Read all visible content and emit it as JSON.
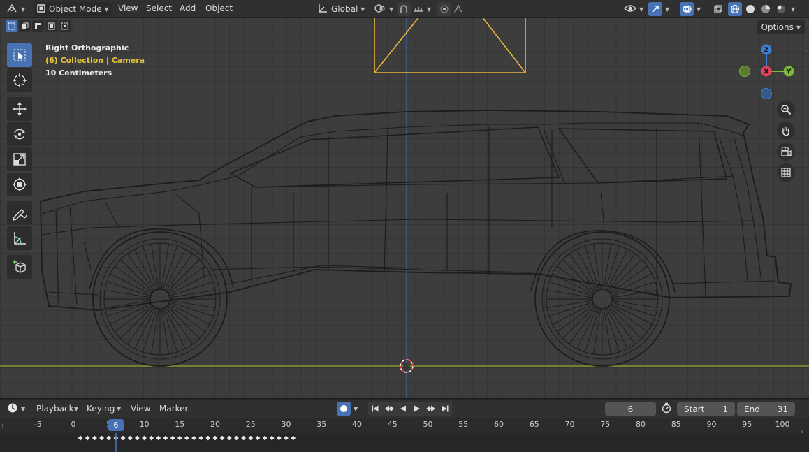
{
  "header": {
    "mode": "Object Mode",
    "menus": [
      "View",
      "Select",
      "Add",
      "Object"
    ],
    "transform_orientation": "Global",
    "icons": [
      "editor-type-icon",
      "object-mode-icon",
      "orientation-icon",
      "pivot-icon",
      "snap-icon",
      "snap-increment-icon",
      "proportional-edit-icon",
      "falloff-icon",
      "visibility-icon",
      "gizmo-icon",
      "overlay-icon",
      "xray-icon",
      "wireframe-shading-icon",
      "solid-shading-icon",
      "material-shading-icon",
      "rendered-shading-icon"
    ]
  },
  "viewport": {
    "view_name": "Right Orthographic",
    "collection_prefix": "(6) Collection",
    "separator": "|",
    "active_object": "Camera",
    "scale_label": "10 Centimeters",
    "options_label": "Options",
    "gizmo": {
      "x": "X",
      "y": "Y",
      "z": "Z"
    }
  },
  "toolbar": {
    "tools": [
      "select-box",
      "cursor",
      "move",
      "rotate",
      "scale",
      "transform",
      "annotate",
      "measure",
      "add-cube"
    ]
  },
  "timeline": {
    "menus": [
      "Playback",
      "Keying",
      "View",
      "Marker"
    ],
    "current_frame": "6",
    "start_label": "Start",
    "start_value": "1",
    "end_label": "End",
    "end_value": "31",
    "ticks": [
      "-5",
      "0",
      "5",
      "10",
      "15",
      "20",
      "25",
      "30",
      "35",
      "40",
      "45",
      "50",
      "55",
      "60",
      "65",
      "70",
      "75",
      "80",
      "85",
      "90",
      "95",
      "100"
    ],
    "playhead_label": "6"
  },
  "colors": {
    "accent": "#4772b3",
    "collection_text": "#e8c33a",
    "axis_x": "#e0445e",
    "axis_y": "#7fbb35",
    "axis_z": "#3f7fd1",
    "camera": "#e9b43a"
  }
}
